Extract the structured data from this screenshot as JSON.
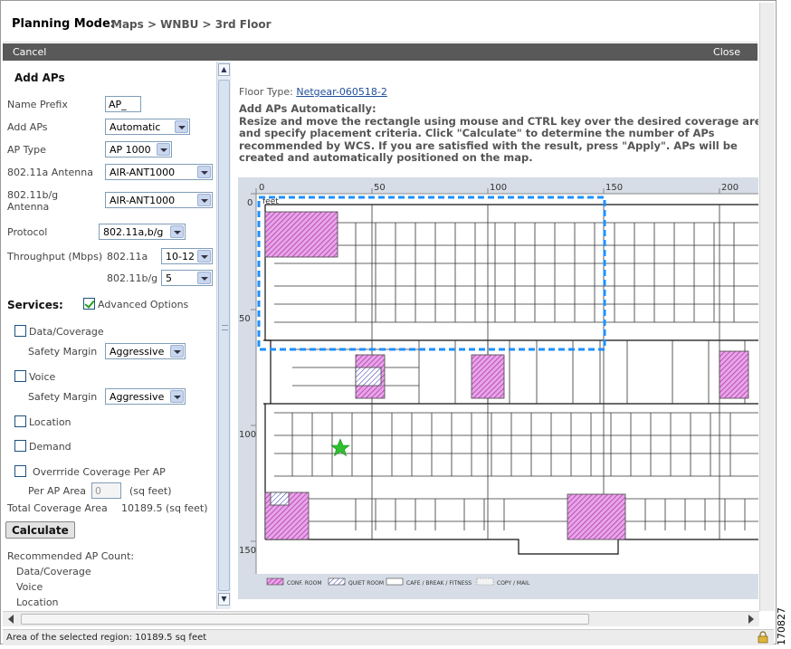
{
  "header": {
    "mode_label": "Planning Mode:",
    "breadcrumb": "Maps > WNBU > 3rd Floor"
  },
  "actions": {
    "cancel": "Cancel",
    "close": "Close"
  },
  "panel": {
    "title": "Add APs",
    "name_prefix": {
      "label": "Name Prefix",
      "value": "AP_"
    },
    "add_aps": {
      "label": "Add APs",
      "value": "Automatic"
    },
    "ap_type": {
      "label": "AP Type",
      "value": "AP 1000"
    },
    "antenna_a": {
      "label": "802.11a Antenna",
      "value": "AIR-ANT1000"
    },
    "antenna_bg": {
      "label1": "802.11b/g",
      "label2": "Antenna",
      "value": "AIR-ANT1000"
    },
    "protocol": {
      "label": "Protocol",
      "value": "802.11a,b/g"
    },
    "throughput": {
      "label": "Throughput (Mbps)",
      "a_label": "802.11a",
      "a_value": "10-12",
      "bg_label": "802.11b/g",
      "bg_value": "5"
    },
    "services": {
      "label": "Services:",
      "advanced": "Advanced Options",
      "advanced_checked": true
    },
    "data_coverage": {
      "label": "Data/Coverage",
      "margin_label": "Safety Margin",
      "margin_value": "Aggressive"
    },
    "voice": {
      "label": "Voice",
      "margin_label": "Safety Margin",
      "margin_value": "Aggressive"
    },
    "location": {
      "label": "Location"
    },
    "demand": {
      "label": "Demand"
    },
    "override": {
      "label": "Overrride Coverage Per AP",
      "area_label": "Per AP Area",
      "area_value": "0",
      "area_unit": "(sq feet)"
    },
    "total": {
      "label": "Total Coverage Area",
      "value": "10189.5 (sq feet)"
    },
    "calculate": "Calculate",
    "recommended": {
      "label": "Recommended AP Count:",
      "items": [
        "Data/Coverage",
        "Voice",
        "Location"
      ]
    }
  },
  "main": {
    "floor_type_label": "Floor Type:",
    "floor_type_link": "Netgear-060518-2",
    "desc_title": "Add APs Automatically:",
    "desc_body": "Resize and move the rectangle using mouse and CTRL key over the desired coverage area and specify placement criteria. Click \"Calculate\" to determine the number of APs recommended by WCS. If you are satisfied with the result, press \"Apply\". APs will be created and automatically positioned on the map.",
    "ruler_x": [
      "0",
      "50",
      "100",
      "150",
      "200"
    ],
    "ruler_y": [
      "0",
      "50",
      "100",
      "150"
    ],
    "ruler_unit": "feet",
    "legend": [
      "CONF. ROOM",
      "QUIET ROOM",
      "CAFE / BREAK / FITNESS",
      "COPY / MAIL"
    ]
  },
  "status": {
    "text": "Area of the selected region: 10189.5 sq feet"
  },
  "figure_id": "170827",
  "colors": {
    "action_bar": "#595959",
    "selection": "#1e90ff",
    "conf_room": "#c040c0",
    "ap_marker": "#2ec02e"
  }
}
